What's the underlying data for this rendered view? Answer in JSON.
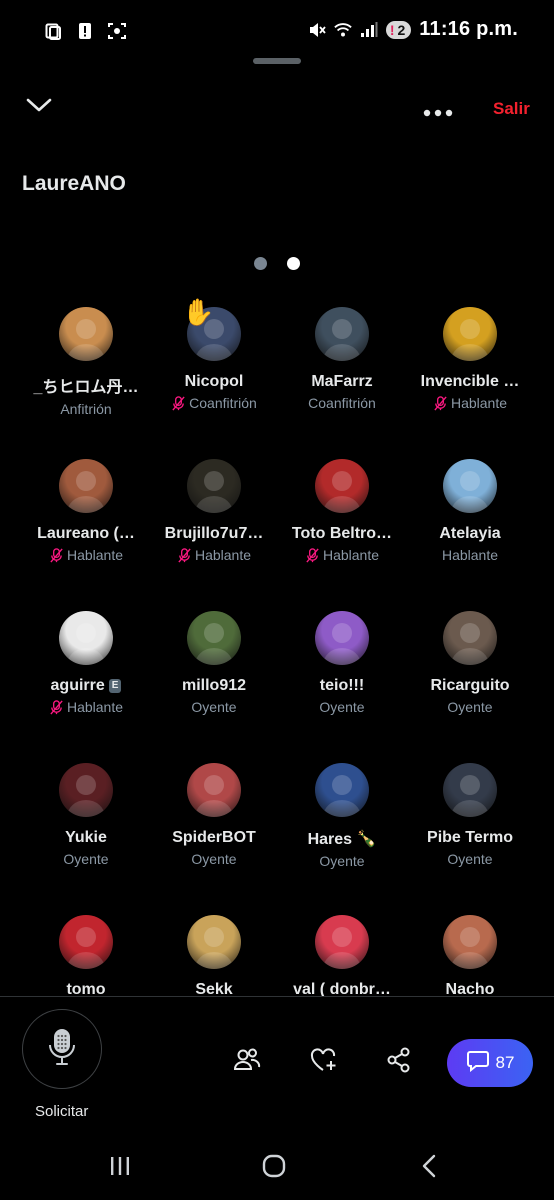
{
  "status": {
    "time": "11:16 p.m.",
    "badge_count": "2",
    "left_icons": [
      "screenshot-icon",
      "alert-icon",
      "scan-icon"
    ],
    "right_icons": [
      "mute-icon",
      "wifi-icon",
      "signal-icon"
    ]
  },
  "header": {
    "leave_label": "Salir",
    "more_icon": "more-icon",
    "collapse_icon": "chevron-down-icon"
  },
  "space": {
    "title": "LaureANO",
    "page_count": 2,
    "active_page": 2
  },
  "colors": {
    "accent": "#f4212e",
    "chat_gradient_start": "#5d3bf3",
    "chat_gradient_end": "#3b63f3",
    "muted_text": "#8b98a5"
  },
  "participants": [
    {
      "name": "_ちヒロム丹…",
      "role": "Anfitrión",
      "muted": false,
      "color": "#c98d4f"
    },
    {
      "name": "Nicopol",
      "role": "Coanfitrión",
      "muted": true,
      "color": "#3b4a6b",
      "hand": "✋"
    },
    {
      "name": "MaFarrz",
      "role": "Coanfitrión",
      "muted": false,
      "color": "#3f4f5e"
    },
    {
      "name": "Invencible …",
      "role": "Hablante",
      "muted": true,
      "color": "#d4a020"
    },
    {
      "name": "Laureano (…",
      "role": "Hablante",
      "muted": true,
      "color": "#a05a3d"
    },
    {
      "name": "Brujillo7u7…",
      "role": "Hablante",
      "muted": true,
      "color": "#2c2a22"
    },
    {
      "name": "Toto Beltro…",
      "role": "Hablante",
      "muted": true,
      "color": "#b22a2a"
    },
    {
      "name": "Atelayia",
      "role": "Hablante",
      "muted": false,
      "color": "#7fb0d8"
    },
    {
      "name": "aguirre",
      "role": "Hablante",
      "muted": true,
      "color": "#e9e9e9",
      "badge": "E"
    },
    {
      "name": "millo912",
      "role": "Oyente",
      "muted": false,
      "color": "#4f6b3a"
    },
    {
      "name": "teio!!!",
      "role": "Oyente",
      "muted": false,
      "color": "#8e5bc7"
    },
    {
      "name": "Ricarguito",
      "role": "Oyente",
      "muted": false,
      "color": "#6b5a4e"
    },
    {
      "name": "Yukie",
      "role": "Oyente",
      "muted": false,
      "color": "#5a1f23"
    },
    {
      "name": "SpiderBOT",
      "role": "Oyente",
      "muted": false,
      "color": "#b04848"
    },
    {
      "name": "Hares 🍾",
      "role": "Oyente",
      "muted": false,
      "color": "#2e4f8f"
    },
    {
      "name": "Pibe Termo",
      "role": "Oyente",
      "muted": false,
      "color": "#333b4a"
    },
    {
      "name": "tomo",
      "role": "",
      "muted": false,
      "color": "#c1252e"
    },
    {
      "name": "Sekk",
      "role": "",
      "muted": false,
      "color": "#c9a35a"
    },
    {
      "name": "val ( donbr…",
      "role": "",
      "muted": false,
      "color": "#d83b4f"
    },
    {
      "name": "Nacho",
      "role": "",
      "muted": false,
      "color": "#b86a4e"
    }
  ],
  "bottom": {
    "request_label": "Solicitar",
    "chat_count": "87",
    "actions": [
      "people-icon",
      "heart-add-icon",
      "share-icon"
    ]
  },
  "navbar": [
    "recent-apps-icon",
    "home-icon",
    "back-icon"
  ]
}
